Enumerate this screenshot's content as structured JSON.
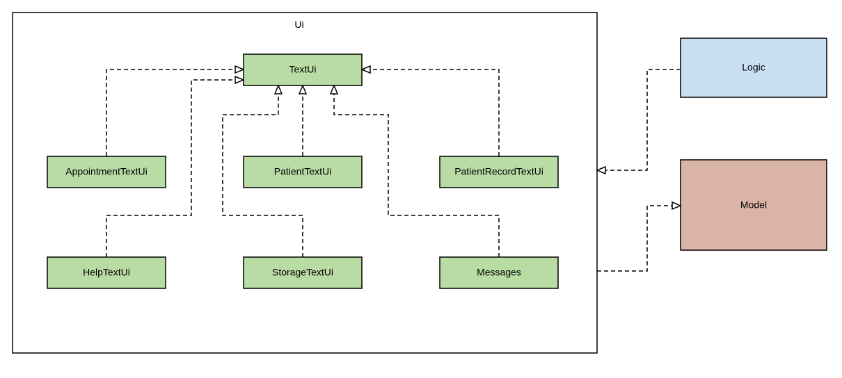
{
  "package": {
    "label": "Ui"
  },
  "classes": {
    "textui": "TextUi",
    "appointment": "AppointmentTextUi",
    "patient": "PatientTextUi",
    "patientrecord": "PatientRecordTextUi",
    "help": "HelpTextUi",
    "storage": "StorageTextUi",
    "messages": "Messages"
  },
  "external": {
    "logic": "Logic",
    "model": "Model"
  },
  "colors": {
    "green": "#b9dca5",
    "blue": "#cbdff4",
    "rose": "#dab4a7",
    "border": "#000000"
  }
}
